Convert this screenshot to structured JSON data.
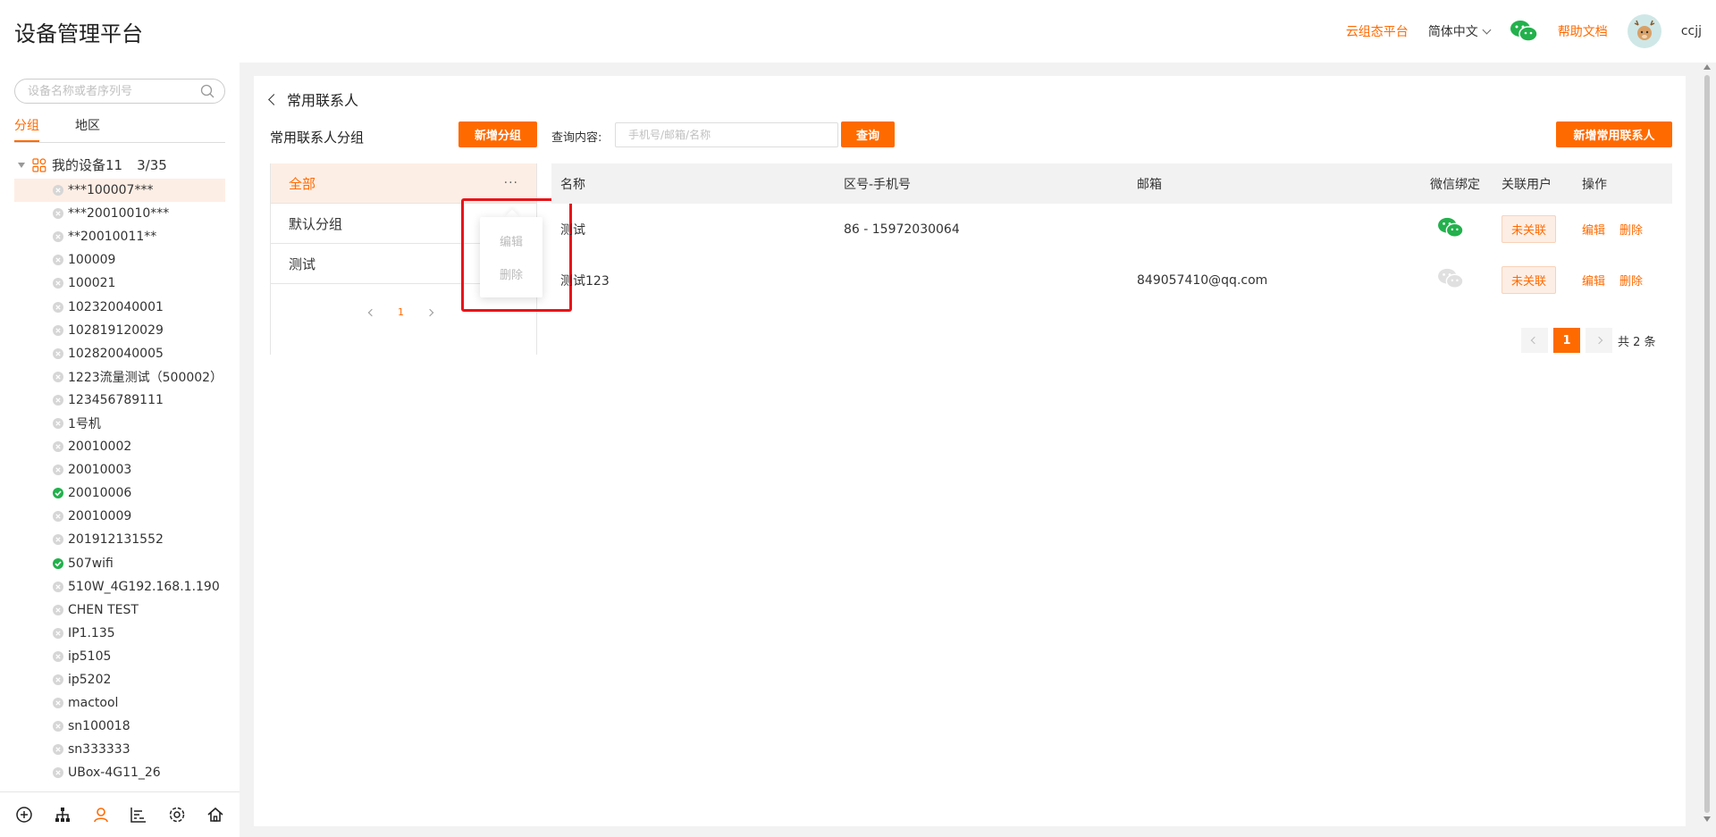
{
  "header": {
    "title": "设备管理平台",
    "cloud_link": "云组态平台",
    "language": "简体中文",
    "help_link": "帮助文档",
    "username": "ccjj",
    "accent_color": "#ff6a00"
  },
  "sidebar": {
    "search_placeholder": "设备名称或者序列号",
    "tabs": [
      {
        "label": "分组",
        "active": true
      },
      {
        "label": "地区",
        "active": false
      }
    ],
    "root": {
      "label": "我的设备11",
      "count": "3/35"
    },
    "devices": [
      {
        "label": "***100007***",
        "online": false,
        "selected": true
      },
      {
        "label": "***20010010***",
        "online": false
      },
      {
        "label": "**20010011**",
        "online": false
      },
      {
        "label": "100009",
        "online": false
      },
      {
        "label": "100021",
        "online": false
      },
      {
        "label": "102320040001",
        "online": false
      },
      {
        "label": "102819120029",
        "online": false
      },
      {
        "label": "102820040005",
        "online": false
      },
      {
        "label": "1223流量测试（500002）",
        "online": false
      },
      {
        "label": "123456789111",
        "online": false
      },
      {
        "label": "1号机",
        "online": false
      },
      {
        "label": "20010002",
        "online": false
      },
      {
        "label": "20010003",
        "online": false
      },
      {
        "label": "20010006",
        "online": true
      },
      {
        "label": "20010009",
        "online": false
      },
      {
        "label": "201912131552",
        "online": false
      },
      {
        "label": "507wifi",
        "online": true
      },
      {
        "label": "510W_4G192.168.1.190",
        "online": false
      },
      {
        "label": "CHEN TEST",
        "online": false
      },
      {
        "label": "IP1.135",
        "online": false
      },
      {
        "label": "ip5105",
        "online": false
      },
      {
        "label": "ip5202",
        "online": false
      },
      {
        "label": "mactool",
        "online": false
      },
      {
        "label": "sn100018",
        "online": false
      },
      {
        "label": "sn333333",
        "online": false
      },
      {
        "label": "UBox-4G11_26",
        "online": false
      }
    ],
    "bottom_icons": [
      "add-circle-icon",
      "org-chart-icon",
      "user-icon",
      "chart-icon",
      "settings-icon",
      "home-icon"
    ]
  },
  "page": {
    "back_title": "常用联系人",
    "group_title": "常用联系人分组",
    "add_group_label": "新增分组",
    "groups": [
      {
        "label": "全部",
        "active": true,
        "more": "···"
      },
      {
        "label": "默认分组",
        "active": false
      },
      {
        "label": "测试",
        "active": false
      }
    ],
    "group_page": "1",
    "popover": {
      "edit": "编辑",
      "delete": "删除"
    },
    "query_label": "查询内容:",
    "query_placeholder": "手机号/邮箱/名称",
    "query_button": "查询",
    "add_contact_label": "新增常用联系人"
  },
  "table": {
    "headers": {
      "name": "名称",
      "phone": "区号-手机号",
      "email": "邮箱",
      "wechat": "微信绑定",
      "link": "关联用户",
      "op": "操作"
    },
    "rows": [
      {
        "name": "测试",
        "phone": "86 - 15972030064",
        "email": "",
        "wechat_bound": true,
        "link": "未关联",
        "edit": "编辑",
        "delete": "删除"
      },
      {
        "name": "测试123",
        "phone": "",
        "email": "849057410@qq.com",
        "wechat_bound": false,
        "link": "未关联",
        "edit": "编辑",
        "delete": "删除"
      }
    ]
  },
  "pager": {
    "current": "1",
    "total": "共 2 条"
  }
}
